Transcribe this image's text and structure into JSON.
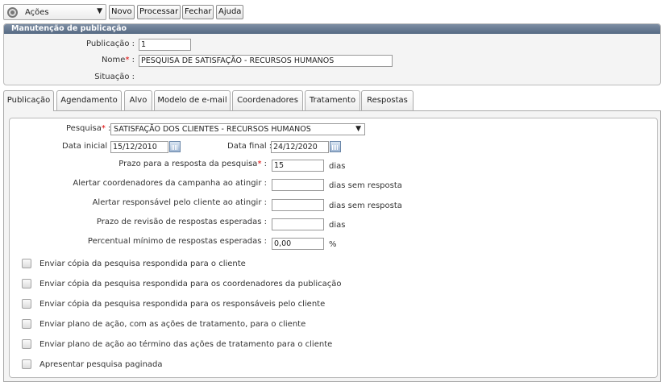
{
  "toolbar": {
    "actions_label": "Ações",
    "buttons": [
      "Novo",
      "Processar",
      "Fechar",
      "Ajuda"
    ]
  },
  "panel": {
    "title": "Manutenção de publicação",
    "publicacao_label": "Publicação :",
    "publicacao_value": "1",
    "nome_label": "Nome",
    "nome_suffix": ":",
    "nome_value": "PESQUISA DE SATISFAÇÃO - RECURSOS HUMANOS",
    "situacao_label": "Situação :"
  },
  "tabs": [
    "Publicação",
    "Agendamento",
    "Alvo",
    "Modelo de e-mail",
    "Coordenadores",
    "Tratamento",
    "Respostas"
  ],
  "form": {
    "pesquisa_label": "Pesquisa",
    "pesquisa_value": "SATISFAÇÃO DOS CLIENTES - RECURSOS HUMANOS",
    "data_inicial_label": "Data inicial :",
    "data_inicial_value": "15/12/2010",
    "data_final_label": "Data final :",
    "data_final_value": "24/12/2020",
    "prazo_label": "Prazo para a resposta da pesquisa",
    "prazo_value": "15",
    "prazo_unit": "dias",
    "alertar_coord_label": "Alertar coordenadores da campanha ao atingir :",
    "alertar_coord_unit": "dias sem resposta",
    "alertar_resp_label": "Alertar responsável pelo cliente ao atingir :",
    "alertar_resp_unit": "dias sem resposta",
    "prazo_revisao_label": "Prazo de revisão de respostas esperadas :",
    "prazo_revisao_unit": "dias",
    "percentual_label": "Percentual mínimo de respostas esperadas :",
    "percentual_value": "0,00",
    "percentual_unit": "%"
  },
  "checkboxes": [
    "Enviar cópia da pesquisa respondida para o cliente",
    "Enviar cópia da pesquisa respondida para os coordenadores da publicação",
    "Enviar cópia da pesquisa respondida para os responsáveis pelo cliente",
    "Enviar plano de ação, com as ações de tratamento, para o cliente",
    "Enviar plano de ação ao término das ações de tratamento para o cliente",
    "Apresentar pesquisa paginada"
  ]
}
